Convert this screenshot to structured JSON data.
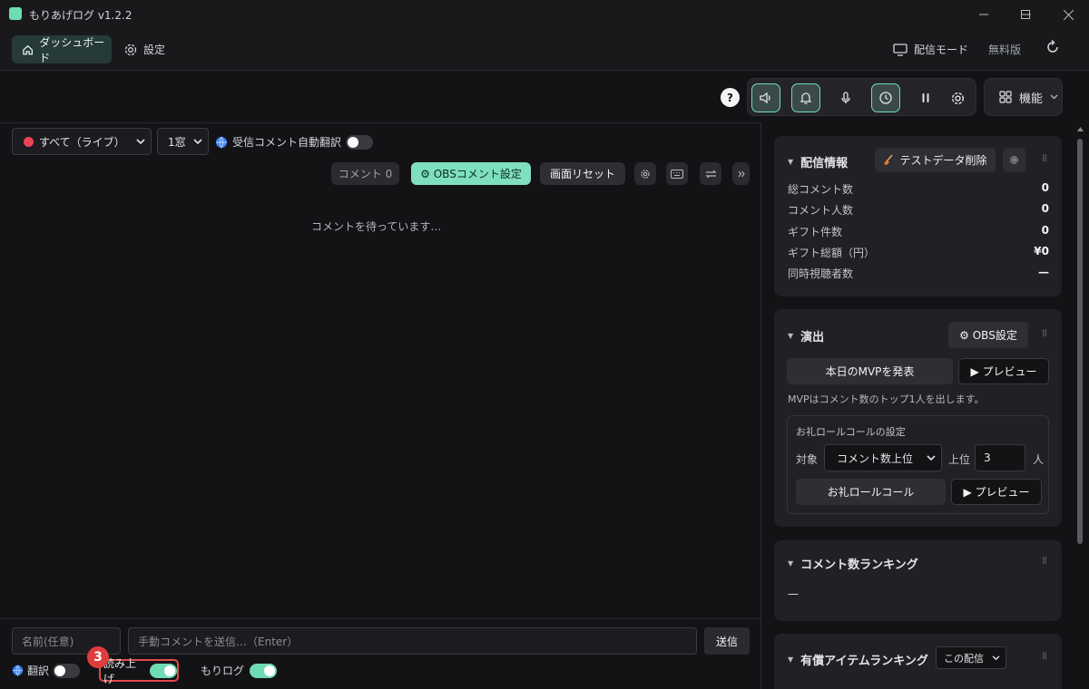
{
  "window": {
    "title": "もりあげログ  v1.2.2"
  },
  "nav": {
    "dashboard": "ダッシュボード",
    "settings": "設定",
    "broadcast_mode": "配信モード",
    "plan": "無料版"
  },
  "toolbar": {
    "help": "?",
    "features": "機能"
  },
  "filters": {
    "source": "すべて（ライブ）",
    "window": "1窓",
    "auto_translate": "受信コメント自動翻訳"
  },
  "actions": {
    "comment_count": "コメント 0",
    "obs_comment_settings": "⚙ OBSコメント設定",
    "screen_reset": "画面リセット"
  },
  "main": {
    "waiting": "コメントを待っています…"
  },
  "bottom": {
    "name_placeholder": "名前(任意)",
    "comment_placeholder": "手動コメントを送信…（Enter）",
    "send": "送信",
    "translate": "翻訳",
    "read_aloud": "読み上げ",
    "morilog": "もりログ",
    "badge": "3"
  },
  "broadcast_info": {
    "title": "配信情報",
    "clear_test_data": "テストデータ削除",
    "stats": [
      {
        "label": "総コメント数",
        "value": "0"
      },
      {
        "label": "コメント人数",
        "value": "0"
      },
      {
        "label": "ギフト件数",
        "value": "0"
      },
      {
        "label": "ギフト総額（円）",
        "value": "¥0"
      },
      {
        "label": "同時視聴者数",
        "value": "—"
      }
    ]
  },
  "effects": {
    "title": "演出",
    "obs_settings": "⚙ OBS設定",
    "mvp_button": "本日のMVPを発表",
    "preview": "▶ プレビュー",
    "mvp_note": "MVPはコメント数のトップ1人を出します。",
    "rollcall_title": "お礼ロールコールの設定",
    "target_label": "対象",
    "target_value": "コメント数上位",
    "top_label": "上位",
    "top_value": "3",
    "people_unit": "人",
    "rollcall_button": "お礼ロールコール",
    "rollcall_preview": "▶ プレビュー"
  },
  "comment_ranking": {
    "title": "コメント数ランキング",
    "value": "—"
  },
  "paid_ranking": {
    "title": "有償アイテムランキング",
    "scope": "この配信"
  },
  "colors": {
    "accent": "#6fdcb4",
    "alert": "#e03c3c",
    "live_dot": "#ef4458"
  }
}
